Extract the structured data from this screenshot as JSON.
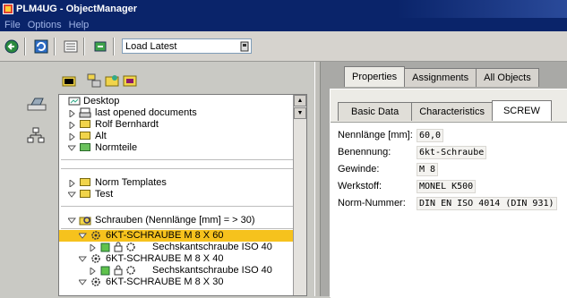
{
  "window": {
    "title": "PLM4UG - ObjectManager"
  },
  "menu": {
    "items": [
      "File",
      "Options",
      "Help"
    ]
  },
  "toolbar": {
    "load_select": "Load Latest"
  },
  "tree": {
    "rows": [
      {
        "label": "Desktop"
      },
      {
        "label": "last opened documents"
      },
      {
        "label": "Rolf Bernhardt"
      },
      {
        "label": "Alt"
      },
      {
        "label": "Normteile"
      },
      {
        "label": "Norm Templates"
      },
      {
        "label": "Test"
      },
      {
        "label": "Schrauben (Nennlänge [mm] = > 30)"
      },
      {
        "label": "6KT-SCHRAUBE  M 8 X 60"
      },
      {
        "label": "Sechskantschraube ISO 40"
      },
      {
        "label": "6KT-SCHRAUBE  M 8 X 40"
      },
      {
        "label": "Sechskantschraube ISO 40"
      },
      {
        "label": "6KT-SCHRAUBE  M 8 X 30"
      }
    ]
  },
  "tabs_main": [
    "Properties",
    "Assignments",
    "All Objects"
  ],
  "tabs_sub": [
    "Basic Data",
    "Characteristics",
    "SCREW"
  ],
  "properties": [
    {
      "label": "Nennlänge [mm]:",
      "value": "60,0"
    },
    {
      "label": "Benennung:",
      "value": "6kt-Schraube"
    },
    {
      "label": "Gewinde:",
      "value": "M 8"
    },
    {
      "label": "Werkstoff:",
      "value": "MONEL K500"
    },
    {
      "label": "Norm-Nummer:",
      "value": "DIN EN ISO 4014 (DIN 931)"
    }
  ],
  "colors": {
    "titlebar": "#0a246a",
    "selection": "#f6c21d",
    "folder": "#f1d44a"
  }
}
